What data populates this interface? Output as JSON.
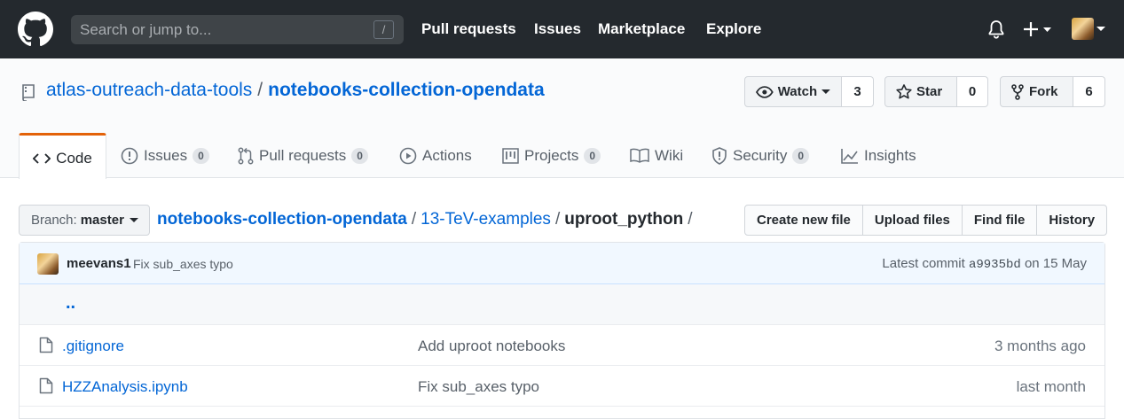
{
  "header": {
    "search_placeholder": "Search or jump to...",
    "search_key": "/",
    "nav": [
      "Pull requests",
      "Issues",
      "Marketplace",
      "Explore"
    ]
  },
  "repo": {
    "owner": "atlas-outreach-data-tools",
    "separator": "/",
    "name": "notebooks-collection-opendata",
    "watch": {
      "label": "Watch",
      "count": "3"
    },
    "star": {
      "label": "Star",
      "count": "0"
    },
    "fork": {
      "label": "Fork",
      "count": "6"
    }
  },
  "tabs": [
    {
      "label": "Code"
    },
    {
      "label": "Issues",
      "count": "0"
    },
    {
      "label": "Pull requests",
      "count": "0"
    },
    {
      "label": "Actions"
    },
    {
      "label": "Projects",
      "count": "0"
    },
    {
      "label": "Wiki"
    },
    {
      "label": "Security",
      "count": "0"
    },
    {
      "label": "Insights"
    }
  ],
  "file_nav": {
    "branch_label": "Branch:",
    "branch": "master",
    "breadcrumb": {
      "root": "notebooks-collection-opendata",
      "mid": "13-TeV-examples",
      "current": "uproot_python",
      "sep": "/"
    },
    "actions": [
      "Create new file",
      "Upload files",
      "Find file",
      "History"
    ]
  },
  "commit": {
    "author": "meevans1",
    "message": "Fix sub_axes typo",
    "latest_label": "Latest commit",
    "sha": "a9935bd",
    "date": "on 15 May"
  },
  "files": {
    "parent": "..",
    "rows": [
      {
        "name": ".gitignore",
        "message": "Add uproot notebooks",
        "age": "3 months ago"
      },
      {
        "name": "HZZAnalysis.ipynb",
        "message": "Fix sub_axes typo",
        "age": "last month"
      }
    ]
  },
  "colors": {
    "header_bg": "#24292e",
    "link": "#0366d6",
    "tab_accent": "#e36209",
    "commit_bg": "#f1f8ff"
  }
}
